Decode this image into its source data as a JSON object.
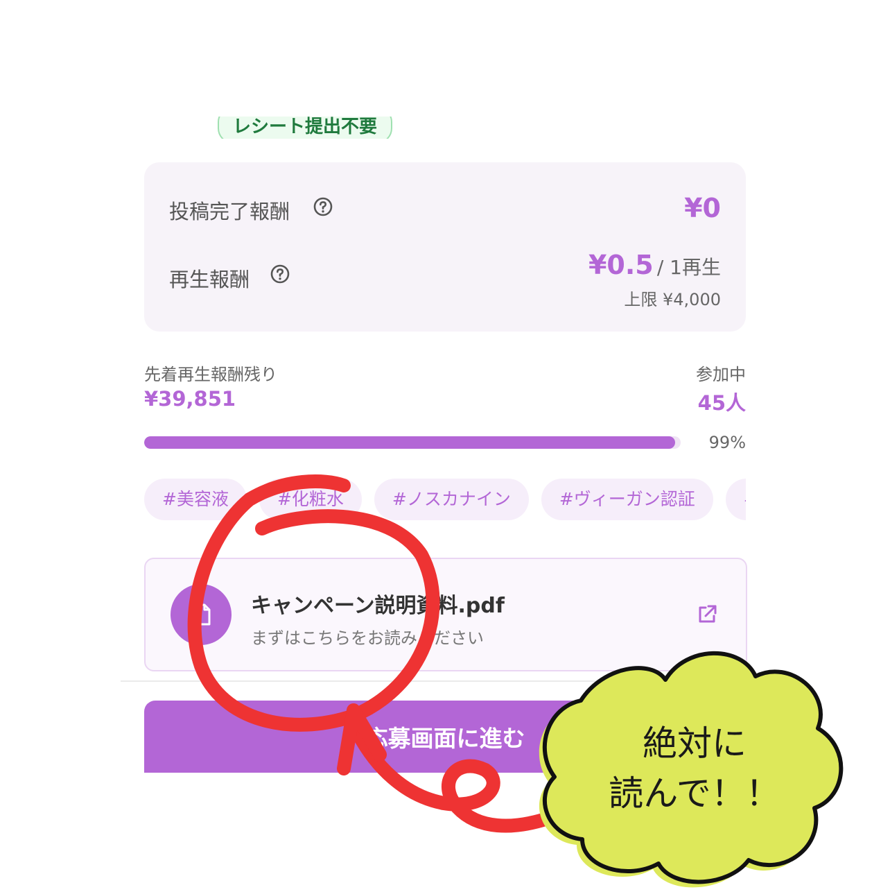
{
  "badge": {
    "label": "レシート提出不要"
  },
  "rewards": {
    "completion_label": "投稿完了報酬",
    "completion_value": "¥0",
    "play_label": "再生報酬",
    "play_value": "¥0.5",
    "play_unit": "/ 1再生",
    "play_cap": "上限 ¥4,000"
  },
  "remaining": {
    "label": "先着再生報酬残り",
    "value": "¥39,851",
    "participants_label": "参加中",
    "participants_value": "45人",
    "progress_text": "99%",
    "progress_fraction": 0.99
  },
  "tags": [
    "#美容液",
    "#化粧水",
    "#ノスカナイン",
    "#ヴィーガン認証",
    "#"
  ],
  "pdf": {
    "title": "キャンペーン説明資料.pdf",
    "subtitle": "まずはこちらをお読みください"
  },
  "apply_button": {
    "label": "応募画面に進む"
  },
  "annotation": {
    "line1": "絶対に",
    "line2": "読んで！！"
  },
  "colors": {
    "accent": "#b366d6",
    "badge_green": "#1f7a3d",
    "card_bg": "#f7f3f9",
    "annotation_red": "#ee3333",
    "cloud_fill": "#dde85a"
  },
  "icons": {
    "help": "question-circle-icon",
    "document": "document-icon",
    "external": "external-link-icon"
  }
}
